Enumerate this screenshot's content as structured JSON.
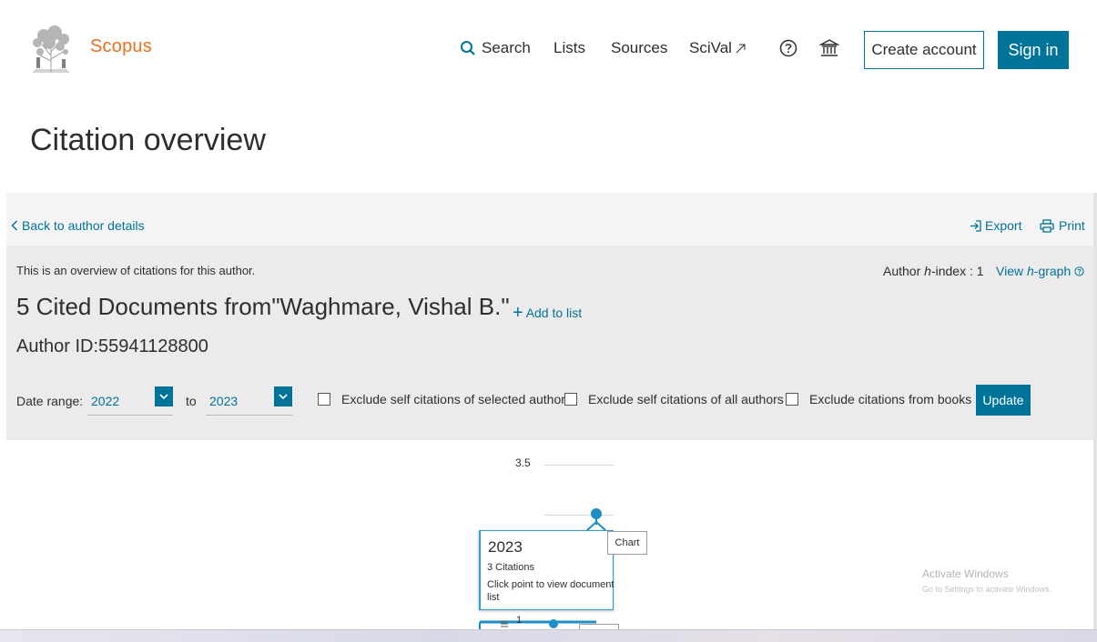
{
  "header": {
    "brand": "Scopus",
    "nav": {
      "search": "Search",
      "lists": "Lists",
      "sources": "Sources",
      "scival": "SciVal"
    },
    "create_account": "Create account",
    "sign_in": "Sign in",
    "icons": [
      "search-icon",
      "external-link-icon",
      "help-icon",
      "institution-icon"
    ]
  },
  "page_title": "Citation overview",
  "toolbar": {
    "back": "Back to author details",
    "export": "Export",
    "print": "Print"
  },
  "overview": {
    "intro": "This is an overview of citations for this author.",
    "h_index_prefix": "Author ",
    "h_index_letter": "h",
    "h_index_suffix": "-index : 1",
    "view_prefix": "View ",
    "view_letter": "h",
    "view_suffix": "-graph",
    "title": "5 Cited Documents from\"Waghmare, Vishal B.\"",
    "add_to_list": "Add to list",
    "author_id": "Author ID:55941128800"
  },
  "filters": {
    "date_range_label": "Date range:",
    "from_year": "2022",
    "to_label": "to",
    "to_year": "2023",
    "exclude_self_selected": "Exclude self citations of selected author",
    "exclude_self_all": "Exclude self citations of all authors",
    "exclude_books": "Exclude citations from books",
    "update": "Update"
  },
  "chart": {
    "y_tick_top": "3.5",
    "y_tick_bottom": "1",
    "tooltip_year": "2023",
    "tooltip_citations": "3 Citations",
    "tooltip_hint": "Click point to view document list",
    "chart_label": "Chart"
  },
  "chart_data": {
    "type": "line",
    "x": [
      "2023"
    ],
    "series": [
      {
        "values": [
          3
        ]
      }
    ],
    "yticks": [
      3.5,
      1
    ]
  },
  "watermark": {
    "line1": "Activate Windows",
    "line2": "Go to Settings to activate Windows."
  },
  "colors": {
    "brand": "#e9711c",
    "accent": "#007398",
    "chart_line": "#1c8fc7"
  }
}
